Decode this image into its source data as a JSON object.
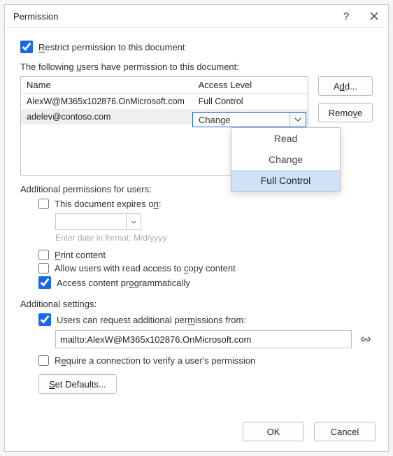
{
  "title": "Permission",
  "helpGlyph": "?",
  "restrict": {
    "label_html": "<u>R</u>estrict permission to this document",
    "checked": true
  },
  "usersIntro_html": "The following <u>u</u>sers have permission to this document:",
  "headers": {
    "name": "Name",
    "access": "Access Level"
  },
  "rows": [
    {
      "name": "AlexW@M365x102876.OnMicrosoft.com",
      "access": "Full Control",
      "selected": false
    },
    {
      "name": "adelev@contoso.com",
      "access": "Change",
      "selected": true
    }
  ],
  "combo": {
    "value": "Change",
    "options": [
      "Read",
      "Change",
      "Full Control"
    ],
    "highlight": 2
  },
  "buttons": {
    "add_html": "A<u>d</u>d...",
    "remove_html": "Remo<u>v</u>e"
  },
  "addlUsers": "Additional permissions for users:",
  "expires": {
    "label_html": "This document expires o<u>n</u>:",
    "checked": false,
    "hint": "Enter date in format: M/d/yyyy"
  },
  "print": {
    "label_html": "<u>P</u>rint content",
    "checked": false
  },
  "copy": {
    "label_html": "Allow users with read access to <u>c</u>opy content",
    "checked": false
  },
  "prog": {
    "label_html": "Access content pr<u>o</u>grammatically",
    "checked": true
  },
  "addlSettings": "Additional settings:",
  "request": {
    "label_html": "Users can request additional per<u>m</u>issions from:",
    "checked": true,
    "value": "mailto:AlexW@M365x102876.OnMicrosoft.com"
  },
  "verify": {
    "label_html": "R<u>e</u>quire a connection to verify a user's permission",
    "checked": false
  },
  "setDefaults_html": "<u>S</u>et Defaults...",
  "ok": "OK",
  "cancel": "Cancel"
}
